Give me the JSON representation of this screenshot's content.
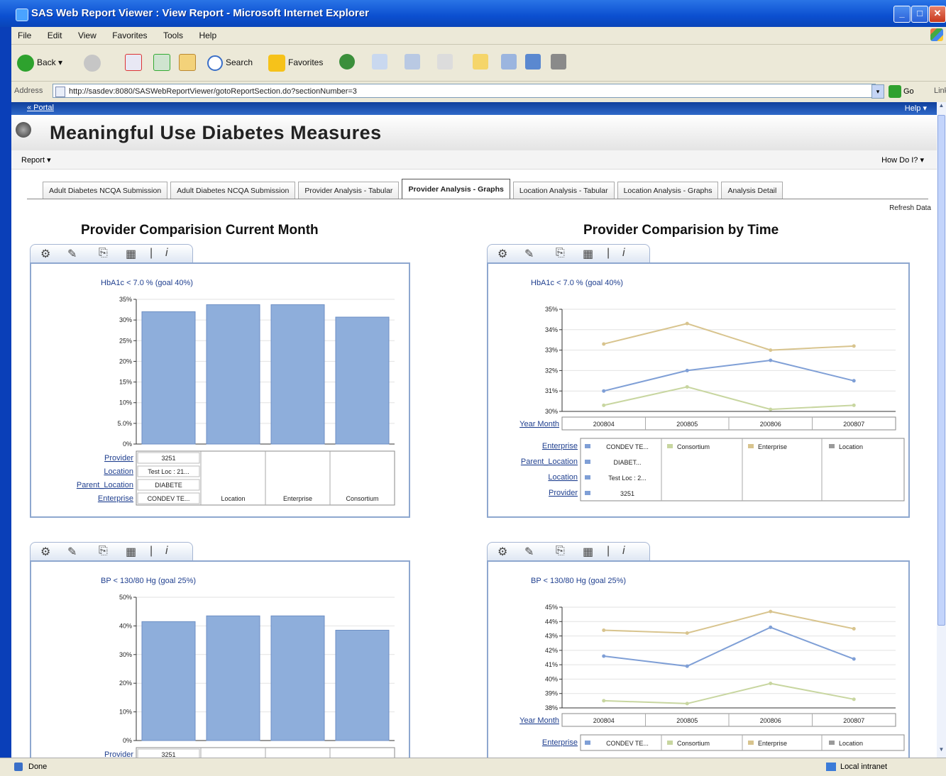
{
  "window": {
    "title": "SAS Web Report Viewer : View Report - Microsoft Internet Explorer",
    "minimize": "_",
    "maximize": "□",
    "close": "✕"
  },
  "menu": [
    "File",
    "Edit",
    "View",
    "Favorites",
    "Tools",
    "Help"
  ],
  "toolbar": {
    "back": "Back",
    "search": "Search",
    "favorites": "Favorites"
  },
  "address": {
    "label": "Address",
    "url": "http://sasdev:8080/SASWebReportViewer/gotoReportSection.do?sectionNumber=3",
    "go": "Go",
    "links": "Links"
  },
  "portal": {
    "link": "« Portal",
    "help": "Help ▾"
  },
  "page": {
    "title": "Meaningful Use Diabetes Measures",
    "report_menu": "Report ▾",
    "howdoi": "How Do I? ▾",
    "refresh": "Refresh Data"
  },
  "tabs": [
    {
      "label": "Adult Diabetes NCQA Submission",
      "active": false
    },
    {
      "label": "Adult Diabetes NCQA Submission",
      "active": false
    },
    {
      "label": "Provider Analysis - Tabular",
      "active": false
    },
    {
      "label": "Provider Analysis - Graphs",
      "active": true
    },
    {
      "label": "Location Analysis - Tabular",
      "active": false
    },
    {
      "label": "Location Analysis - Graphs",
      "active": false
    },
    {
      "label": "Analysis Detail",
      "active": false
    }
  ],
  "headings": {
    "current_month": "Provider Comparision Current Month",
    "by_time": "Provider Comparision by Time"
  },
  "status": {
    "left": "Done",
    "right": "Local intranet"
  },
  "colors": {
    "bar": "#8eaedb",
    "provider_line": "#7f9fd6",
    "enterprise_line": "#d8c48e",
    "consortium_line": "#c8d6a0"
  },
  "chart_data": [
    {
      "type": "bar",
      "title": "HbA1c < 7.0 % (goal 40%)",
      "categories": [
        "Provider",
        "Location",
        "Enterprise",
        "Consortium"
      ],
      "values": [
        32,
        33.7,
        33.7,
        30.7
      ],
      "ylim": [
        0,
        35
      ],
      "yticks": [
        "0%",
        "5.0%",
        "10%",
        "15%",
        "20%",
        "25%",
        "30%",
        "35%"
      ],
      "row_labels": [
        "Provider",
        "Location",
        "Parent_Location",
        "Enterprise"
      ],
      "provider_cells": [
        "3251",
        "Test Loc : 21...",
        "DIABETE",
        "CONDEV TE..."
      ],
      "category_labels": [
        "Location",
        "Enterprise",
        "Consortium"
      ]
    },
    {
      "type": "line",
      "title": "HbA1c < 7.0 % (goal 40%)",
      "x": [
        "200804",
        "200805",
        "200806",
        "200807"
      ],
      "xlabel": "Year Month",
      "ylim": [
        30,
        35
      ],
      "yticks": [
        "30%",
        "31%",
        "32%",
        "33%",
        "34%",
        "35%"
      ],
      "series": [
        {
          "name": "Enterprise",
          "values": [
            33.3,
            34.3,
            33.0,
            33.2
          ]
        },
        {
          "name": "Provider",
          "values": [
            31.0,
            32.0,
            32.5,
            31.5
          ]
        },
        {
          "name": "Consortium",
          "values": [
            30.3,
            31.2,
            30.1,
            30.3
          ]
        }
      ],
      "legend_rows": [
        "Enterprise",
        "Parent_Location",
        "Location",
        "Provider"
      ],
      "legend_cells": [
        "CONDEV TE...",
        "DIABET...",
        "Test Loc : 2...",
        "3251"
      ],
      "legend_series": [
        "Consortium",
        "Enterprise",
        "Location"
      ]
    },
    {
      "type": "bar",
      "title": "BP < 130/80 Hg (goal 25%)",
      "categories": [
        "Provider",
        "Location",
        "Enterprise",
        "Consortium"
      ],
      "values": [
        41.5,
        43.5,
        43.5,
        38.5
      ],
      "ylim": [
        0,
        50
      ],
      "yticks": [
        "0%",
        "10%",
        "20%",
        "30%",
        "40%",
        "50%"
      ],
      "row_labels": [
        "Provider"
      ],
      "provider_cells": [
        "3251"
      ]
    },
    {
      "type": "line",
      "title": "BP < 130/80 Hg (goal 25%)",
      "x": [
        "200804",
        "200805",
        "200806",
        "200807"
      ],
      "xlabel": "Year Month",
      "ylim": [
        38,
        45
      ],
      "yticks": [
        "38%",
        "39%",
        "40%",
        "41%",
        "42%",
        "43%",
        "44%",
        "45%"
      ],
      "series": [
        {
          "name": "Enterprise",
          "values": [
            43.4,
            43.2,
            44.7,
            43.5
          ]
        },
        {
          "name": "Provider",
          "values": [
            41.6,
            40.9,
            43.6,
            41.4
          ]
        },
        {
          "name": "Consortium",
          "values": [
            38.5,
            38.3,
            39.7,
            38.6
          ]
        }
      ],
      "legend_rows": [
        "Enterprise"
      ],
      "legend_cells": [
        "CONDEV TE..."
      ],
      "legend_series": [
        "Consortium",
        "Enterprise",
        "Location"
      ]
    }
  ]
}
